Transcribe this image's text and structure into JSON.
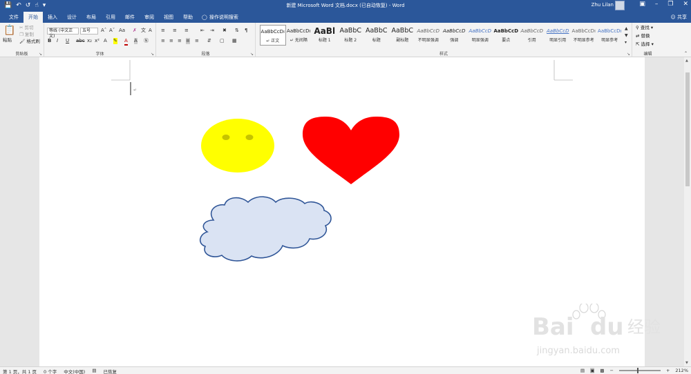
{
  "titlebar": {
    "title": "新建 Microsoft Word 文档.docx (已自动恢复)  -  Word",
    "user": "Zhu Lilan",
    "qat_icons": [
      "save-icon",
      "undo-icon",
      "redo-icon",
      "touch-icon",
      "customize-icon"
    ]
  },
  "tabs": [
    "文件",
    "开始",
    "插入",
    "设计",
    "布局",
    "引用",
    "邮件",
    "审阅",
    "视图",
    "帮助"
  ],
  "active_tab": "开始",
  "tellme": "操作说明搜索",
  "share": "共享",
  "ribbon": {
    "clipboard": {
      "label": "剪贴板",
      "paste": "粘贴",
      "cut": "剪切",
      "copy": "复制",
      "format_painter": "格式刷"
    },
    "font": {
      "label": "字体",
      "font_name": "等线 (中文正文)",
      "font_size": "五号",
      "bold": "B",
      "italic": "I",
      "underline": "U"
    },
    "paragraph": {
      "label": "段落"
    },
    "styles": {
      "label": "样式",
      "items": [
        {
          "sample": "AaBbCcDı",
          "name": "↵ 正文"
        },
        {
          "sample": "AaBbCcDı",
          "name": "↵ 无间隔"
        },
        {
          "sample": "AaBl",
          "name": "标题 1"
        },
        {
          "sample": "AaBbC",
          "name": "标题 2"
        },
        {
          "sample": "AaBbC",
          "name": "标题"
        },
        {
          "sample": "AaBbC",
          "name": "副标题"
        },
        {
          "sample": "AaBbCcD",
          "name": "不明显强调"
        },
        {
          "sample": "AaBbCcD",
          "name": "强调"
        },
        {
          "sample": "AaBbCcD",
          "name": "明显强调"
        },
        {
          "sample": "AaBbCcD",
          "name": "要点"
        },
        {
          "sample": "AaBbCcD",
          "name": "引用"
        },
        {
          "sample": "AaBbCcD",
          "name": "明显引用"
        },
        {
          "sample": "AaBbCcDı",
          "name": "不明显参考"
        },
        {
          "sample": "AaBbCcDı",
          "name": "明显参考"
        }
      ]
    },
    "editing": {
      "label": "编辑",
      "find": "查找",
      "replace": "替换",
      "select": "选择"
    }
  },
  "document": {
    "shapes": [
      "smiley-face",
      "heart",
      "cloud"
    ],
    "colors": {
      "smiley": "#ffff00",
      "smiley_eyes": "#c6c300",
      "heart": "#ff0000",
      "cloud_fill": "#dae3f3",
      "cloud_stroke": "#2f5597"
    }
  },
  "statusbar": {
    "page": "第 1 页，共 1 页",
    "words": "0 个字",
    "language": "中文(中国)",
    "recovered": "已恢复",
    "zoom": "212%"
  },
  "watermark": {
    "brand": "Bai",
    "brand2": "du",
    "cn": "经验",
    "url": "jingyan.baidu.com"
  }
}
